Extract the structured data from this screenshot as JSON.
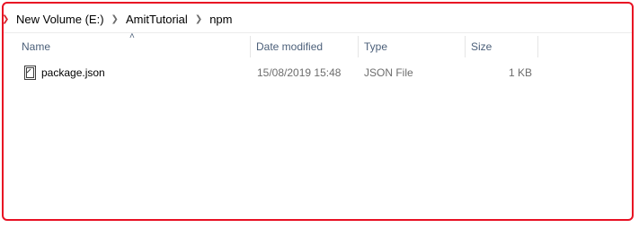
{
  "breadcrumb": {
    "items": [
      "New Volume (E:)",
      "AmitTutorial",
      "npm"
    ]
  },
  "columns": {
    "name": "Name",
    "date_modified": "Date modified",
    "type": "Type",
    "size": "Size",
    "sort_indicator": "^"
  },
  "files": [
    {
      "name": "package.json",
      "date_modified": "15/08/2019 15:48",
      "type": "JSON File",
      "size": "1 KB",
      "icon": "json-file-icon"
    }
  ],
  "colors": {
    "highlight_border": "#e81123",
    "header_text": "#4c607a"
  }
}
